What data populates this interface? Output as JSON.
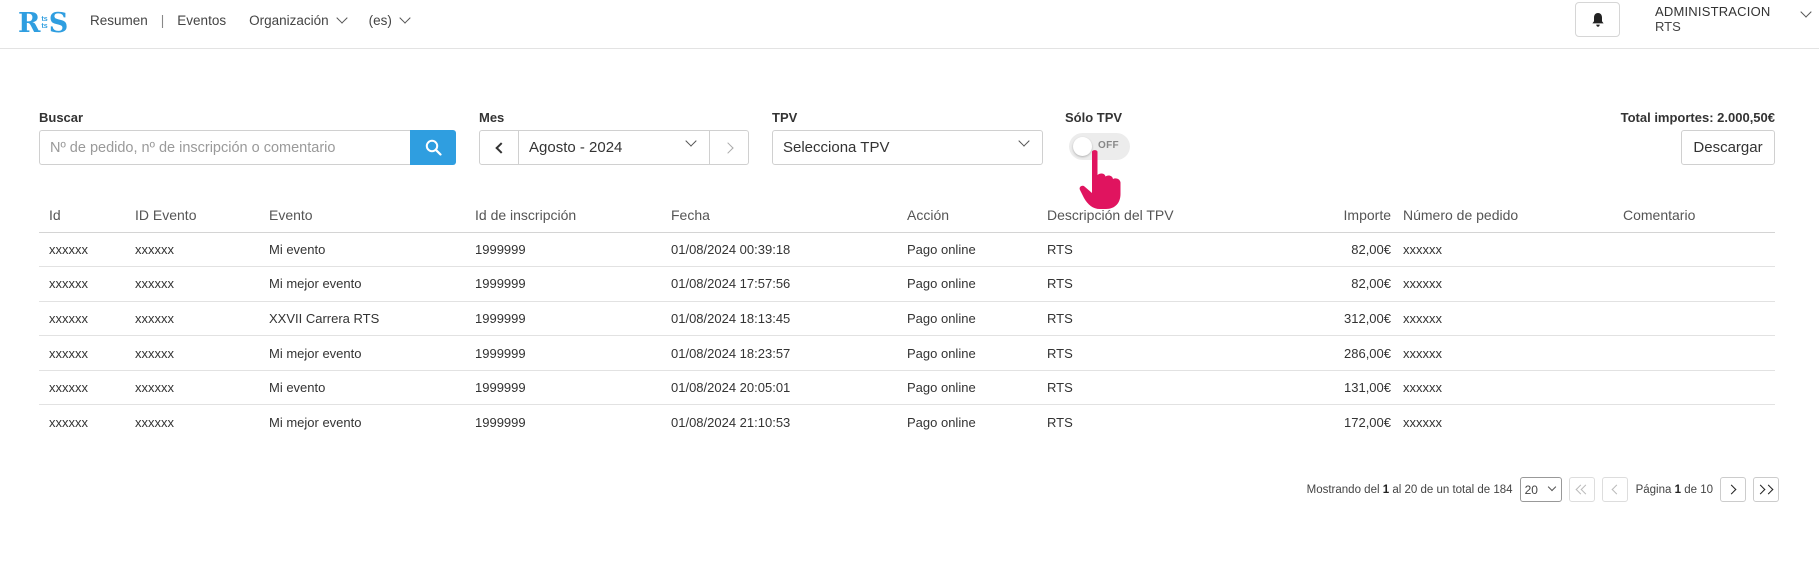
{
  "header": {
    "logo": {
      "r": "R",
      "mid_top": "ts",
      "mid_bot": "ts",
      "s": "S"
    },
    "nav": {
      "resumen": "Resumen",
      "separator": "|",
      "eventos": "Eventos",
      "organizacion": "Organización",
      "language": "(es)"
    },
    "user": {
      "name": "ADMINISTRACION",
      "org": "RTS"
    }
  },
  "filters": {
    "search": {
      "label": "Buscar",
      "placeholder": "Nº de pedido, nº de inscripción o comentario"
    },
    "month": {
      "label": "Mes",
      "value": "Agosto - 2024"
    },
    "tpv": {
      "label": "TPV",
      "value": "Selecciona TPV"
    },
    "solo_tpv": {
      "label": "Sólo TPV",
      "state": "OFF"
    },
    "total": "Total importes: 2.000,50€",
    "download": "Descargar"
  },
  "table": {
    "columns": [
      "Id",
      "ID Evento",
      "Evento",
      "Id de inscripción",
      "Fecha",
      "Acción",
      "Descripción del TPV",
      "Importe",
      "Número de pedido",
      "Comentario"
    ],
    "rows": [
      [
        "xxxxxx",
        "xxxxxx",
        "Mi evento",
        "1999999",
        "01/08/2024 00:39:18",
        "Pago online",
        "RTS",
        "82,00€",
        "xxxxxx",
        ""
      ],
      [
        "xxxxxx",
        "xxxxxx",
        "Mi mejor evento",
        "1999999",
        "01/08/2024 17:57:56",
        "Pago online",
        "RTS",
        "82,00€",
        "xxxxxx",
        ""
      ],
      [
        "xxxxxx",
        "xxxxxx",
        "XXVII Carrera RTS",
        "1999999",
        "01/08/2024 18:13:45",
        "Pago online",
        "RTS",
        "312,00€",
        "xxxxxx",
        ""
      ],
      [
        "xxxxxx",
        "xxxxxx",
        "Mi mejor evento",
        "1999999",
        "01/08/2024 18:23:57",
        "Pago online",
        "RTS",
        "286,00€",
        "xxxxxx",
        ""
      ],
      [
        "xxxxxx",
        "xxxxxx",
        "Mi evento",
        "1999999",
        "01/08/2024 20:05:01",
        "Pago online",
        "RTS",
        "131,00€",
        "xxxxxx",
        ""
      ],
      [
        "xxxxxx",
        "xxxxxx",
        "Mi mejor evento",
        "1999999",
        "01/08/2024 21:10:53",
        "Pago online",
        "RTS",
        "172,00€",
        "xxxxxx",
        ""
      ]
    ]
  },
  "pagination": {
    "showing_prefix": "Mostrando del",
    "from": "1",
    "al": "al",
    "to": "20",
    "total_prefix": "de un total de",
    "total": "184",
    "per_page": "20",
    "page_prefix": "Página",
    "page": "1",
    "page_of": "de",
    "pages": "10"
  },
  "colors": {
    "accent": "#2f9ee0",
    "pointer": "#e0145f"
  },
  "icons": [
    "bell-icon",
    "search-icon",
    "chevron-down-icon",
    "chevron-left-icon",
    "chevron-right-icon",
    "double-chevron-left-icon",
    "double-chevron-right-icon",
    "hand-pointer-icon"
  ]
}
